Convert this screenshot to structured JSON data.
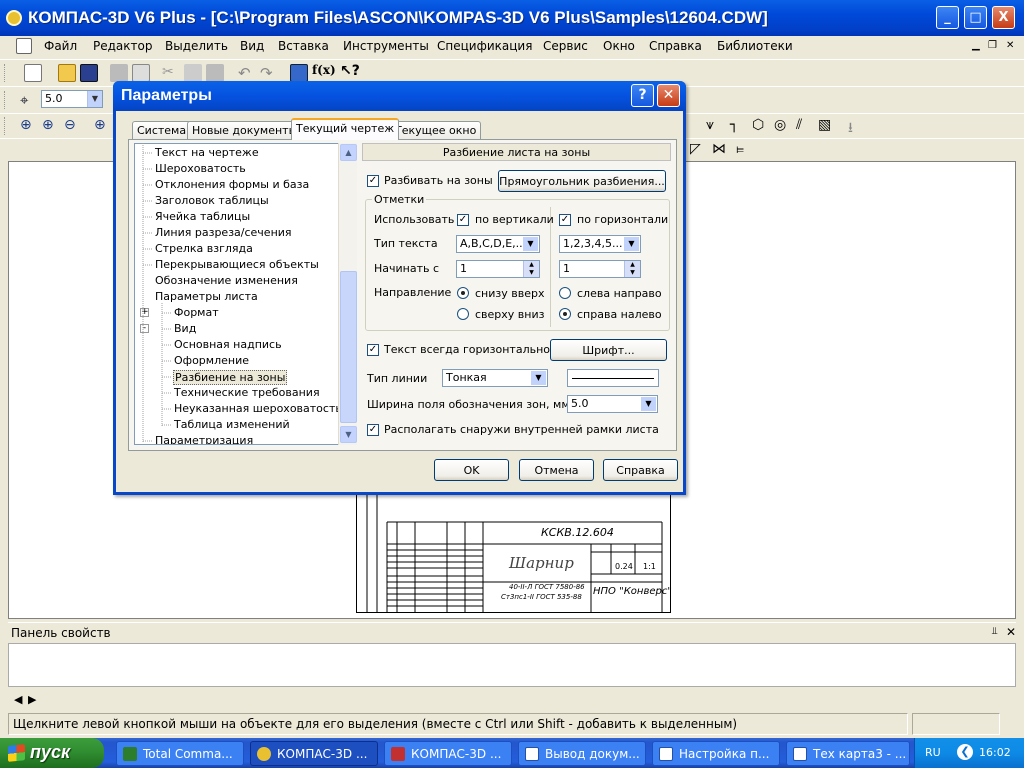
{
  "window": {
    "title": "КОМПАС-3D V6 Plus - [C:\\Program Files\\ASCON\\KOMPAS-3D V6 Plus\\Samples\\12604.CDW]",
    "controls": [
      "_",
      "□",
      "X"
    ]
  },
  "menubar": [
    "Файл",
    "Редактор",
    "Выделить",
    "Вид",
    "Вставка",
    "Инструменты",
    "Спецификация",
    "Сервис",
    "Окно",
    "Справка",
    "Библиотеки"
  ],
  "toolbar": {
    "step_value": "5.0"
  },
  "drawing": {
    "code": "КСКВ.12.604",
    "name": "Шарнир",
    "org": "НПО \"Конверс\"",
    "mass": "0.24",
    "scale": "1:1",
    "material_1": "40-II-Л ГОСТ 7580-86",
    "material_2": "Ст3пс1-II ГОСТ 535-88"
  },
  "properties_panel": {
    "title": "Панель свойств"
  },
  "status": {
    "hint": "Щелкните левой кнопкой мыши на объекте для его выделения (вместе с Ctrl или Shift - добавить к выделенным)"
  },
  "taskbar": {
    "start": "пуск",
    "tasks": [
      "Total Comma...",
      "КОМПАС-3D ...",
      "КОМПАС-3D ...",
      "Вывод докум...",
      "Настройка п...",
      "Тех карта3 - ..."
    ],
    "lang": "RU",
    "time": "16:02"
  },
  "dialog": {
    "title": "Параметры",
    "tabs": [
      "Система",
      "Новые документы",
      "Текущий чертеж",
      "Текущее окно"
    ],
    "tree": [
      {
        "label": "Текст на чертеже",
        "level": 0
      },
      {
        "label": "Шероховатость",
        "level": 0
      },
      {
        "label": "Отклонения формы и база",
        "level": 0
      },
      {
        "label": "Заголовок таблицы",
        "level": 0
      },
      {
        "label": "Ячейка таблицы",
        "level": 0
      },
      {
        "label": "Линия разреза/сечения",
        "level": 0
      },
      {
        "label": "Стрелка взгляда",
        "level": 0
      },
      {
        "label": "Перекрывающиеся объекты",
        "level": 0
      },
      {
        "label": "Обозначение изменения",
        "level": 0,
        "expander": "+"
      },
      {
        "label": "Параметры листа",
        "level": 0,
        "expander": "-"
      },
      {
        "label": "Формат",
        "level": 1
      },
      {
        "label": "Вид",
        "level": 1
      },
      {
        "label": "Основная надпись",
        "level": 1
      },
      {
        "label": "Оформление",
        "level": 1
      },
      {
        "label": "Разбиение на зоны",
        "level": 1,
        "selected": true
      },
      {
        "label": "Технические требования",
        "level": 1
      },
      {
        "label": "Неуказанная шероховатость",
        "level": 1
      },
      {
        "label": "Таблица изменений",
        "level": 1
      },
      {
        "label": "Параметризация",
        "level": 0
      }
    ],
    "section_header": "Разбиение листа на зоны",
    "split_zones": {
      "label": "Разбивать на зоны",
      "checked": true
    },
    "rect_button": "Прямоугольник разбиения...",
    "marks": {
      "group_label": "Отметки",
      "use_label": "Использовать",
      "vertical": {
        "label": "по вертикали",
        "checked": true
      },
      "horizontal": {
        "label": "по горизонтали",
        "checked": true
      },
      "text_type_label": "Тип текста",
      "text_type_v": "A,B,C,D,E,...",
      "text_type_h": "1,2,3,4,5...",
      "start_label": "Начинать с",
      "start_v": "1",
      "start_h": "1",
      "direction_label": "Направление",
      "dir_v_options": [
        {
          "label": "снизу вверх",
          "selected": true
        },
        {
          "label": "сверху вниз",
          "selected": false
        }
      ],
      "dir_h_options": [
        {
          "label": "слева направо",
          "selected": false
        },
        {
          "label": "справа налево",
          "selected": true
        }
      ]
    },
    "text_horizontal": {
      "label": "Текст всегда горизонтально",
      "checked": true
    },
    "font_button": "Шрифт...",
    "line_type_label": "Тип линии",
    "line_type": "Тонкая",
    "zone_width_label": "Ширина поля обозначения зон, мм",
    "zone_width": "5.0",
    "outside_frame": {
      "label": "Располагать снаружи внутренней рамки листа",
      "checked": true
    },
    "buttons": {
      "ok": "OK",
      "cancel": "Отмена",
      "help": "Справка"
    }
  }
}
